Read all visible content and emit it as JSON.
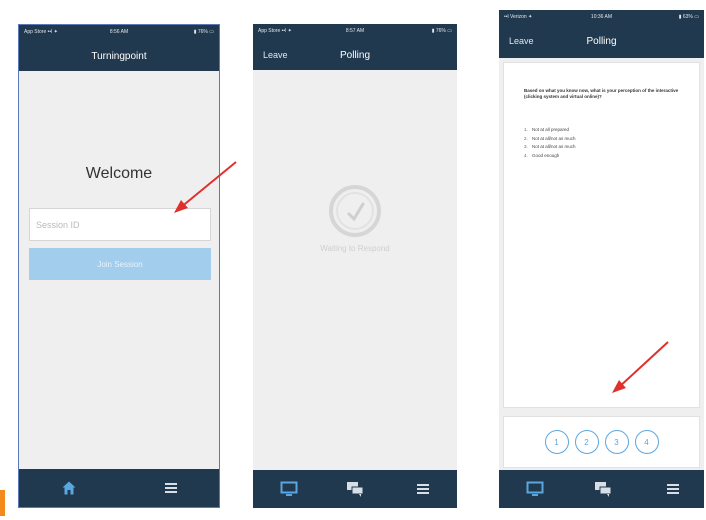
{
  "screen1": {
    "status_left": "App Store ••l ✦",
    "status_time": "8:56 AM",
    "status_right": "▮ 76% ▭",
    "title": "Turningpoint",
    "welcome": "Welcome",
    "session_placeholder": "Session ID",
    "join_label": "Join Session"
  },
  "screen2": {
    "status_left": "App Store ••l ✦",
    "status_time": "8:57 AM",
    "status_right": "▮ 76% ▭",
    "nav_left": "Leave",
    "title": "Polling",
    "waiting_text": "Waiting to Respond"
  },
  "screen3": {
    "status_left": "••l Verizon ✦",
    "status_time": "10:36 AM",
    "status_right": "▮ 63% ▭",
    "nav_left": "Leave",
    "title": "Polling",
    "question": "Based on what you know now, what is your perception of the interactive (clicking system and virtual online)?",
    "options": [
      {
        "num": "1.",
        "text": "Not at all prepared"
      },
      {
        "num": "2.",
        "text": "Not at all/not as much"
      },
      {
        "num": "3.",
        "text": "Not at all/not as much"
      },
      {
        "num": "4.",
        "text": "Good enough"
      }
    ],
    "answer_buttons": [
      "1",
      "2",
      "3",
      "4"
    ]
  },
  "colors": {
    "nav_bar": "#21394e",
    "accent": "#5aa7df",
    "join_button": "#a3cdec",
    "arrow": "#e0302d",
    "page_tab_marker": "#f28a1c"
  },
  "icons": {
    "home": "home-icon",
    "monitor": "monitor-icon",
    "chat": "chat-icon",
    "menu": "menu-icon",
    "clock": "clock-icon"
  }
}
